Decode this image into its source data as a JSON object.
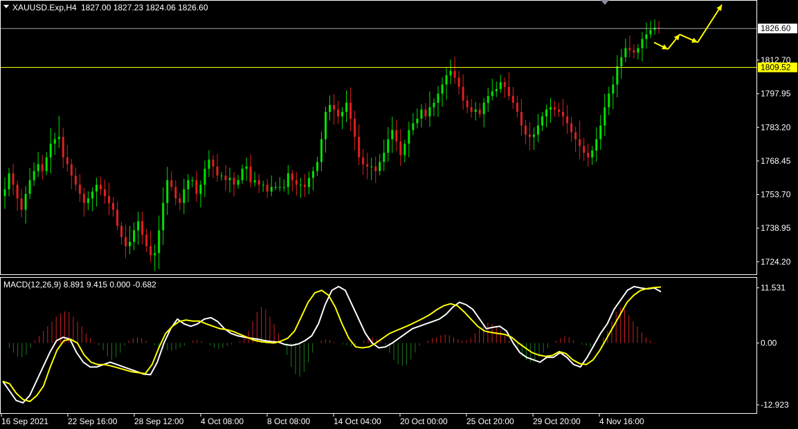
{
  "header": {
    "symbol": "XAUUSD.Exp,H4",
    "ohlc": "1827.00 1827.23 1824.06 1826.60"
  },
  "macd_header": "MACD(12,26,9) 8.891 9.415 0.000 -0.682",
  "colors": {
    "background": "#000000",
    "bull": "#00e400",
    "bear": "#e02020",
    "price_line": "#a0a4ae",
    "level_line": "#ffff00",
    "macd_line": "#ffffff",
    "signal_line": "#ffff00",
    "hist_pos": "#d02020",
    "hist_neg": "#1e7a1e",
    "border": "#ffffff",
    "arrow": "#ffff00"
  },
  "chart_data": [
    {
      "type": "candlestick",
      "title": "XAUUSD.Exp,H4",
      "y_ticks": [
        "1812.70",
        "1797.95",
        "1783.20",
        "1768.45",
        "1753.70",
        "1738.95",
        "1724.20"
      ],
      "ylim": [
        1719.0,
        1838.5
      ],
      "current_price_label": "1826.60",
      "current_price": 1826.6,
      "level_label": "1809.52",
      "level": 1809.52,
      "x_labels": [
        "16 Sep 2021",
        "22 Sep 16:00",
        "28 Sep 12:00",
        "4 Oct 08:00",
        "8 Oct 08:00",
        "14 Oct 04:00",
        "20 Oct 00:00",
        "25 Oct 20:00",
        "29 Oct 20:00",
        "4 Nov 16:00"
      ],
      "closes": [
        1756,
        1763,
        1758,
        1752,
        1747,
        1754,
        1760,
        1764,
        1767,
        1764,
        1770,
        1776,
        1778,
        1779,
        1770,
        1767,
        1762,
        1758,
        1754,
        1750,
        1752,
        1755,
        1758,
        1756,
        1753,
        1750,
        1747,
        1740,
        1735,
        1731,
        1733,
        1738,
        1742,
        1736,
        1731,
        1727,
        1728,
        1738,
        1750,
        1760,
        1757,
        1752,
        1750,
        1756,
        1760,
        1760,
        1754,
        1758,
        1765,
        1769,
        1766,
        1762,
        1762,
        1760,
        1761,
        1758,
        1760,
        1765,
        1766,
        1759,
        1760,
        1758,
        1758,
        1755,
        1757,
        1757,
        1757,
        1757,
        1763,
        1760,
        1758,
        1758,
        1757,
        1761,
        1764,
        1768,
        1778,
        1790,
        1793,
        1791,
        1788,
        1790,
        1794,
        1787,
        1779,
        1770,
        1767,
        1766,
        1766,
        1764,
        1768,
        1772,
        1778,
        1782,
        1777,
        1771,
        1776,
        1782,
        1785,
        1787,
        1791,
        1788,
        1792,
        1794,
        1798,
        1802,
        1806,
        1808,
        1805,
        1801,
        1795,
        1792,
        1790,
        1791,
        1789,
        1794,
        1797,
        1799,
        1800,
        1803,
        1801,
        1797,
        1794,
        1790,
        1784,
        1780,
        1779,
        1780,
        1784,
        1788,
        1791,
        1792,
        1791,
        1790,
        1788,
        1785,
        1781,
        1778,
        1775,
        1772,
        1770,
        1773,
        1778,
        1784,
        1792,
        1798,
        1802,
        1810,
        1814,
        1818,
        1817,
        1816,
        1818,
        1822,
        1824,
        1826,
        1827,
        1826.6
      ],
      "volatility": [
        7,
        6,
        6,
        5,
        5,
        6,
        6,
        5,
        6,
        5,
        5,
        6,
        7,
        8,
        6,
        6,
        5,
        5,
        6,
        6,
        5,
        5,
        6,
        5,
        5,
        6,
        6,
        5,
        5,
        6,
        6,
        5,
        6,
        6,
        5,
        7,
        7,
        6,
        6,
        6,
        5,
        5,
        5,
        5,
        5,
        5,
        5,
        5,
        5,
        5,
        5,
        5,
        5,
        5,
        5,
        5,
        5,
        5,
        5,
        5,
        5,
        5,
        5,
        5,
        5,
        5,
        5,
        5,
        5,
        5,
        5,
        5,
        5,
        5,
        5,
        6,
        7,
        7,
        6,
        6,
        5,
        5,
        6,
        6,
        5,
        5,
        5,
        5,
        5,
        5,
        5,
        5,
        6,
        6,
        6,
        5,
        5,
        5,
        5,
        5,
        5,
        5,
        6,
        6,
        7,
        6,
        6,
        6,
        6,
        5,
        5,
        6,
        5,
        5,
        5,
        6,
        5,
        5,
        5,
        5,
        5,
        6,
        5,
        5,
        6,
        5,
        5,
        5,
        5,
        5,
        5,
        5,
        5,
        5,
        5,
        5,
        5,
        6,
        7,
        6,
        5,
        5,
        5,
        6,
        7,
        8,
        6,
        5,
        5,
        6,
        5,
        5,
        5,
        5,
        5,
        5,
        5,
        4
      ]
    },
    {
      "type": "macd",
      "title": "MACD(12,26,9)",
      "y_ticks": [
        "11.531",
        "0.00",
        "-12.923"
      ],
      "ylim": [
        -14.5,
        13.5
      ],
      "macd": [
        -8,
        -10,
        -12,
        -12.5,
        -11,
        -8,
        -5,
        -2,
        0.5,
        1.2,
        0.8,
        -2,
        -4,
        -5,
        -5,
        -4.5,
        -4,
        -4.5,
        -5,
        -5.5,
        -6,
        -6.5,
        -6.6,
        -4,
        0,
        3,
        5,
        4,
        3.5,
        4,
        5,
        5.3,
        4.5,
        3,
        2,
        1.5,
        1.2,
        1,
        0.8,
        0.5,
        0.3,
        0.2,
        -0.3,
        -0.5,
        -0.2,
        0.5,
        1.5,
        4,
        8,
        11,
        11.8,
        11,
        8,
        5,
        2,
        0,
        -1,
        -0.8,
        0,
        1,
        2,
        3,
        3.5,
        4,
        4.5,
        5,
        6,
        7.5,
        8.5,
        8,
        7,
        5,
        3,
        3.3,
        3.5,
        2.5,
        0,
        -2,
        -3,
        -3.5,
        -4,
        -3,
        -3,
        -2,
        -3,
        -4.5,
        -5,
        -3,
        -0.5,
        2,
        4,
        7,
        9,
        11,
        11.8,
        11.5,
        11.3,
        11.5,
        10.7
      ],
      "signal": [
        -8,
        -8.5,
        -10.5,
        -11.8,
        -12.2,
        -11,
        -9,
        -5,
        -1.5,
        0.5,
        0.8,
        0,
        -2.5,
        -4,
        -4.5,
        -4.5,
        -4.8,
        -5.2,
        -5.6,
        -6,
        -6.2,
        -6.4,
        -4.5,
        -1,
        2,
        3.5,
        4.5,
        4.8,
        4.6,
        4.6,
        4,
        3.5,
        3,
        2.8,
        2.4,
        1.8,
        1.2,
        0.6,
        0.3,
        0.1,
        0,
        0.4,
        1,
        2.5,
        5.5,
        8.5,
        10.5,
        11,
        10,
        7.5,
        4,
        1,
        -0.8,
        -1,
        -0.8,
        0,
        1,
        2,
        2.6,
        3.2,
        3.8,
        4.5,
        5.2,
        6,
        7,
        7.8,
        8.2,
        7.8,
        6.5,
        5,
        3.5,
        2.5,
        2.2,
        2,
        1.8,
        1.2,
        0,
        -1,
        -2,
        -2.5,
        -2.8,
        -2.6,
        -1.8,
        -2.2,
        -3.5,
        -4.3,
        -4.5,
        -3.5,
        -1.5,
        1,
        3.5,
        6,
        8.5,
        10,
        11,
        11.4,
        11.6,
        11.7
      ],
      "histogram": [
        0,
        -1,
        -2,
        -2.8,
        -3,
        -2.5,
        -1,
        0.5,
        1.5,
        2.5,
        3.5,
        4.5,
        5.5,
        6.2,
        6.6,
        6.4,
        5.5,
        4.5,
        3.5,
        2,
        1,
        0.2,
        -0.5,
        -1.5,
        -2.8,
        -3.5,
        -3,
        -2,
        -0.5,
        0.5,
        1,
        1.2,
        1,
        0.5,
        0,
        -0.5,
        -1,
        -1.2,
        -1.5,
        -1.6,
        -1.4,
        -1,
        -0.5,
        0,
        0.5,
        0.6,
        0.3,
        0,
        -0.5,
        -1,
        -1.2,
        -1,
        -0.6,
        -0.3,
        0,
        0.3,
        1,
        2.5,
        4.5,
        6.5,
        7.5,
        7,
        5.5,
        4,
        2,
        0,
        -2.5,
        -5,
        -6.5,
        -7,
        -6,
        -4,
        -2,
        0,
        0.5,
        0.8,
        0.6,
        0.2,
        0,
        -0.3,
        -0.5,
        -0.7,
        -0.5,
        0,
        0.5,
        1,
        1.2,
        0.8,
        0.3,
        -0.5,
        -2,
        -3.5,
        -4.5,
        -4.8,
        -4.5,
        -3.5,
        -2,
        -0.5,
        0,
        0.5,
        1,
        1.2,
        1.6,
        1.8,
        1.6,
        1.2,
        0.8,
        0.4,
        0.6,
        1,
        2,
        3,
        3.8,
        4.2,
        4,
        3.5,
        2.5,
        1.5,
        0.5,
        -0.5,
        -1.5,
        -2.8,
        -3.6,
        -4,
        -3.8,
        -3,
        -2,
        -1,
        0,
        0.5,
        1,
        1.5,
        1.2,
        0.6,
        0,
        -0.3,
        -0.6,
        -0.9,
        -0.6,
        0,
        1,
        2.5,
        4.5,
        6.5,
        7.5,
        7,
        5.8,
        4.5,
        3.5,
        2.2,
        1.2,
        0.5,
        0.1,
        0
      ]
    }
  ],
  "forecast_path": [
    1820.5,
    1817.5,
    1824,
    1820.5,
    1837
  ]
}
